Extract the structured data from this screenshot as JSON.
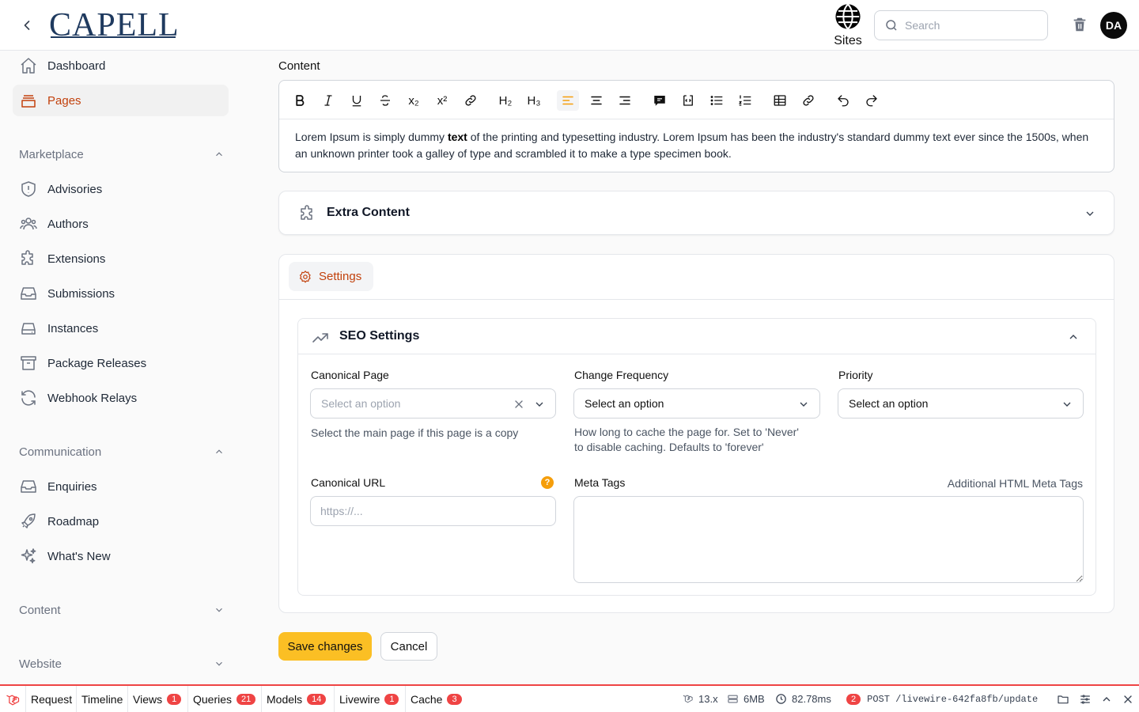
{
  "header": {
    "logo_text": "CAPELL",
    "sites_label": "Sites",
    "search_placeholder": "Search",
    "avatar_initials": "DA"
  },
  "sidebar": {
    "top_items": [
      {
        "label": "Dashboard",
        "icon": "home-icon"
      },
      {
        "label": "Pages",
        "icon": "pages-icon",
        "active": true
      }
    ],
    "groups": [
      {
        "label": "Marketplace",
        "expanded": true,
        "items": [
          {
            "label": "Advisories",
            "icon": "shield-exclamation-icon"
          },
          {
            "label": "Authors",
            "icon": "users-icon"
          },
          {
            "label": "Extensions",
            "icon": "puzzle-icon"
          },
          {
            "label": "Submissions",
            "icon": "inbox-icon"
          },
          {
            "label": "Instances",
            "icon": "server-icon"
          },
          {
            "label": "Package Releases",
            "icon": "archive-box-icon"
          },
          {
            "label": "Webhook Relays",
            "icon": "refresh-icon"
          }
        ]
      },
      {
        "label": "Communication",
        "expanded": true,
        "items": [
          {
            "label": "Enquiries",
            "icon": "inbox-icon"
          },
          {
            "label": "Roadmap",
            "icon": "rocket-icon"
          },
          {
            "label": "What's New",
            "icon": "sparkles-icon"
          }
        ]
      },
      {
        "label": "Content",
        "expanded": false,
        "items": []
      },
      {
        "label": "Website",
        "expanded": false,
        "items": []
      }
    ]
  },
  "editor": {
    "label": "Content",
    "text_before": "Lorem Ipsum is simply dummy ",
    "text_bold": "text",
    "text_after": " of the printing and typesetting industry. Lorem Ipsum has been the industry's standard dummy text ever since the 1500s, when an unknown printer took a galley of type and scrambled it to make a type specimen book.",
    "toolbar": {
      "h2": "H₂",
      "h3": "H₃",
      "subscript": "x₂",
      "superscript": "x²"
    }
  },
  "extra_content": {
    "title": "Extra Content"
  },
  "settings": {
    "tab_label": "Settings",
    "seo": {
      "title": "SEO Settings",
      "canonical_page": {
        "label": "Canonical Page",
        "placeholder": "Select an option",
        "helper": "Select the main page if this page is a copy"
      },
      "change_frequency": {
        "label": "Change Frequency",
        "value": "Select an option",
        "helper_line1": "How long to cache the page for. Set to 'Never'",
        "helper_line2": "to disable caching. Defaults to 'forever'"
      },
      "priority": {
        "label": "Priority",
        "value": "Select an option"
      },
      "canonical_url": {
        "label": "Canonical URL",
        "placeholder": "https://...",
        "help_glyph": "?"
      },
      "meta_tags": {
        "label": "Meta Tags",
        "hint": "Additional HTML Meta Tags"
      }
    }
  },
  "actions": {
    "save": "Save changes",
    "cancel": "Cancel"
  },
  "debugbar": {
    "tabs": [
      {
        "label": "Request",
        "badge": null
      },
      {
        "label": "Timeline",
        "badge": null
      },
      {
        "label": "Views",
        "badge": "1"
      },
      {
        "label": "Queries",
        "badge": "21"
      },
      {
        "label": "Models",
        "badge": "14"
      },
      {
        "label": "Livewire",
        "badge": "1"
      },
      {
        "label": "Cache",
        "badge": "3"
      }
    ],
    "version": "13.x",
    "memory": "6MB",
    "duration": "82.78ms",
    "request_count": "2",
    "request_path": "POST /livewire-642fa8fb/update"
  },
  "colors": {
    "accent": "#c2410c",
    "primary_button": "#fbbf24",
    "debug_red": "#ef4444",
    "help_orange": "#f59e0b"
  }
}
